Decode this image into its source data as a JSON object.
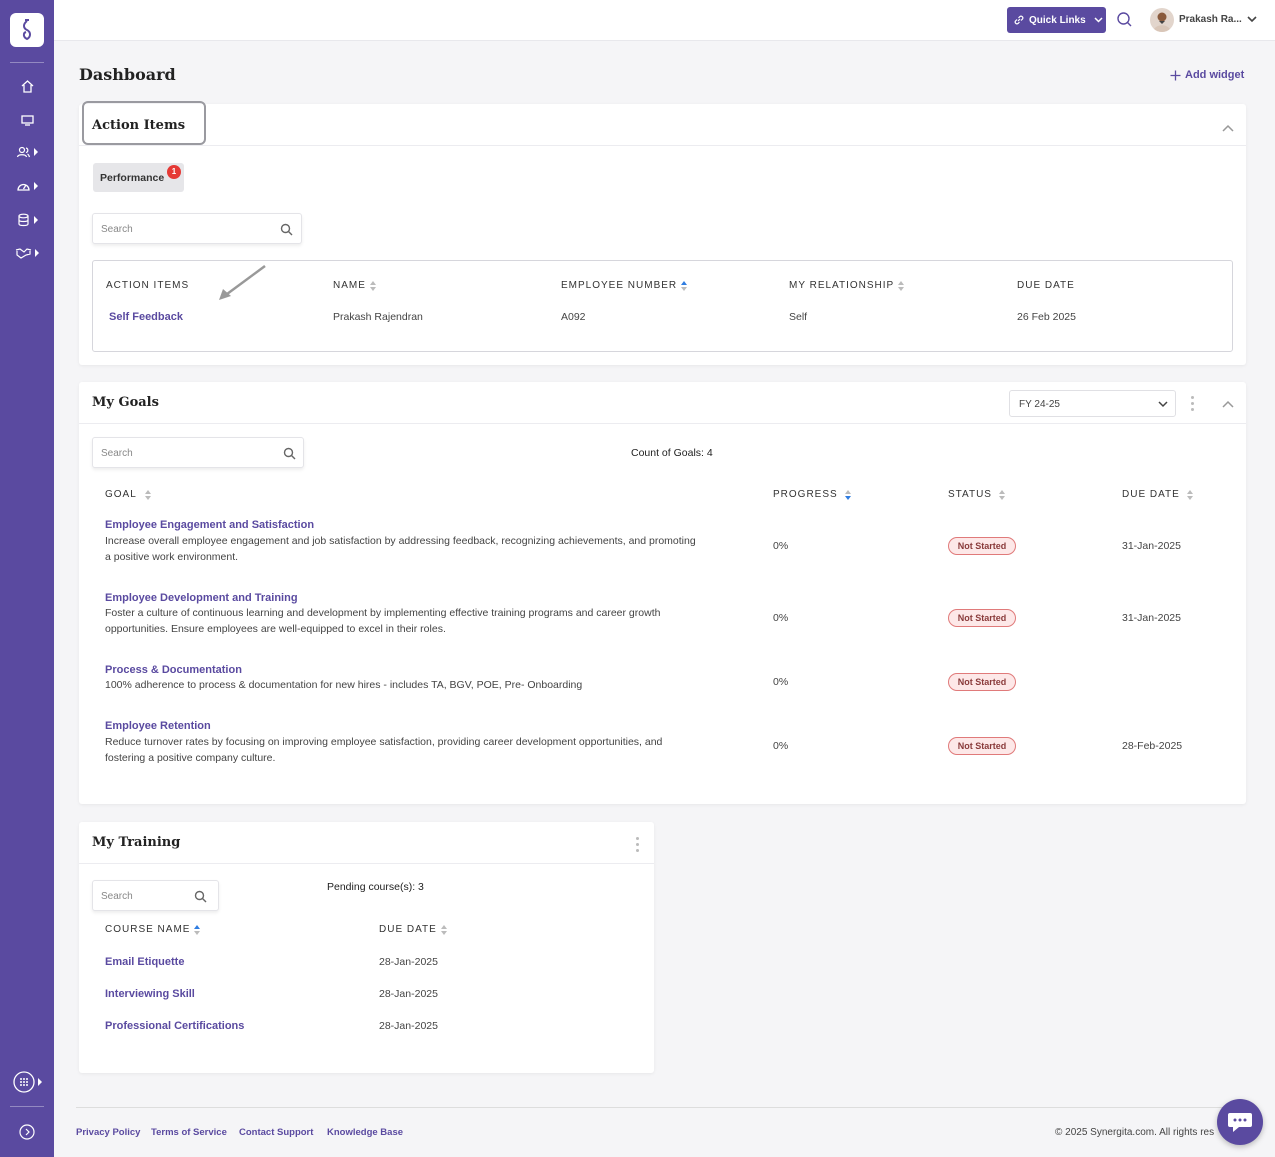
{
  "colors": {
    "brand": "#5a4aa0",
    "badge_bg": "#fde8e8",
    "badge_border": "#e07a7a"
  },
  "sidebar": {
    "items": [
      {
        "icon": "home-icon"
      },
      {
        "icon": "monitor-icon"
      },
      {
        "icon": "users-icon"
      },
      {
        "icon": "gauge-icon"
      },
      {
        "icon": "database-icon"
      },
      {
        "icon": "handshake-icon"
      }
    ],
    "bottom": [
      {
        "icon": "apps-grid-icon"
      },
      {
        "icon": "expand-icon"
      }
    ]
  },
  "topbar": {
    "quick_links_label": "Quick Links",
    "user_name": "Prakash Ra..."
  },
  "page": {
    "title": "Dashboard",
    "add_widget_label": "Add widget"
  },
  "action_items": {
    "title": "Action Items",
    "tab_label": "Performance",
    "tab_badge": "1",
    "search_placeholder": "Search",
    "columns": [
      "ACTION ITEMS",
      "NAME",
      "EMPLOYEE NUMBER",
      "MY RELATIONSHIP",
      "DUE DATE"
    ],
    "rows": [
      {
        "action": "Self Feedback",
        "name": "Prakash Rajendran",
        "employee_number": "A092",
        "relationship": "Self",
        "due_date": "26 Feb 2025"
      }
    ]
  },
  "my_goals": {
    "title": "My Goals",
    "fy_selected": "FY 24-25",
    "search_placeholder": "Search",
    "count_text": "Count of Goals: 4",
    "columns": [
      "GOAL",
      "PROGRESS",
      "STATUS",
      "DUE DATE"
    ],
    "rows": [
      {
        "title": "Employee Engagement and Satisfaction",
        "desc1": "Increase overall employee engagement and job satisfaction by addressing feedback, recognizing achievements, and promoting",
        "desc2": "a positive work environment.",
        "progress": "0%",
        "status": "Not Started",
        "due": "31-Jan-2025"
      },
      {
        "title": "Employee Development and Training",
        "desc1": "Foster a culture of continuous learning and development by implementing effective training programs and career growth",
        "desc2": "opportunities. Ensure employees are well-equipped to excel in their roles.",
        "progress": "0%",
        "status": "Not Started",
        "due": "31-Jan-2025"
      },
      {
        "title": "Process & Documentation",
        "desc1": "100% adherence to process & documentation for new hires - includes TA, BGV, POE, Pre- Onboarding",
        "desc2": "",
        "progress": "0%",
        "status": "Not Started",
        "due": ""
      },
      {
        "title": "Employee Retention",
        "desc1": "Reduce turnover rates by focusing on improving employee satisfaction, providing career development opportunities, and",
        "desc2": "fostering a positive company culture.",
        "progress": "0%",
        "status": "Not Started",
        "due": "28-Feb-2025"
      }
    ]
  },
  "my_training": {
    "title": "My Training",
    "search_placeholder": "Search",
    "pending_text": "Pending course(s): 3",
    "columns": [
      "COURSE NAME",
      "DUE DATE"
    ],
    "rows": [
      {
        "course": "Email Etiquette",
        "due": "28-Jan-2025"
      },
      {
        "course": "Interviewing Skill",
        "due": "28-Jan-2025"
      },
      {
        "course": "Professional Certifications",
        "due": "28-Jan-2025"
      }
    ]
  },
  "footer": {
    "links": [
      "Privacy Policy",
      "Terms of Service",
      "Contact Support",
      "Knowledge Base"
    ],
    "copyright": "© 2025 Synergita.com. All rights res"
  }
}
